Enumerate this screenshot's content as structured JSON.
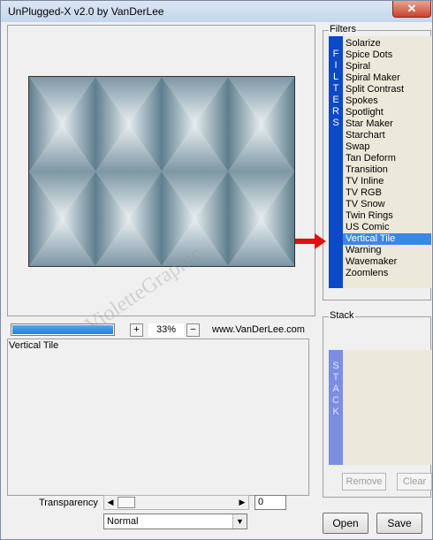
{
  "window": {
    "title": "UnPlugged-X v2.0 by VanDerLee",
    "close_glyph": "✕"
  },
  "preview": {
    "zoom": "33%",
    "zoom_in": "+",
    "zoom_out": "−",
    "progress_pct": 100,
    "url": "www.VanDerLee.com"
  },
  "filter_name": "Vertical Tile",
  "filters": {
    "label": "Filters",
    "bar_letters": [
      "F",
      "I",
      "L",
      "T",
      "E",
      "R",
      "S"
    ],
    "items": [
      "Solarize",
      "Spice Dots",
      "Spiral",
      "Spiral Maker",
      "Split Contrast",
      "Spokes",
      "Spotlight",
      "Star Maker",
      "Starchart",
      "Swap",
      "Tan Deform",
      "Transition",
      "TV Inline",
      "TV RGB",
      "TV Snow",
      "Twin Rings",
      "US Comic",
      "Vertical Tile",
      "Warning",
      "Wavemaker",
      "Zoomlens"
    ],
    "selected": "Vertical Tile",
    "pointer_icon": "red-arrow-icon"
  },
  "stack": {
    "label": "Stack",
    "bar_letters": [
      "S",
      "T",
      "A",
      "C",
      "K"
    ],
    "remove_label": "Remove",
    "clear_label": "Clear"
  },
  "transparency": {
    "label": "Transparency",
    "value": "0",
    "arrow_left": "◀",
    "arrow_right": "▶"
  },
  "blend_mode": {
    "value": "Normal",
    "arrow": "▼"
  },
  "buttons": {
    "open": "Open",
    "save": "Save"
  },
  "watermark": "VioletteGraphic",
  "colors": {
    "accent": "#0d48c6",
    "selection": "#3a88e6",
    "list_bg": "#ede9da",
    "arrow": "#e01010"
  }
}
